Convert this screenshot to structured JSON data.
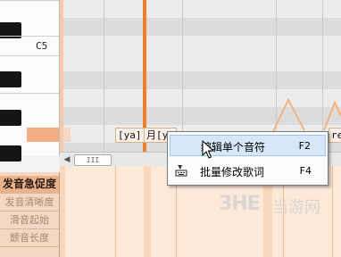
{
  "piano": {
    "octave_label": "C5"
  },
  "lyrics": {
    "note1": "[ya]",
    "note2_prefix": "月[ya",
    "note3": "re"
  },
  "scrollbar": {
    "thumb_label": "III",
    "left_arrow": "◀"
  },
  "parameters": {
    "items": [
      "发音急促度",
      "发音清晰度",
      "滑音起始",
      "颤音长度"
    ],
    "active_index": 0
  },
  "context_menu": {
    "items": [
      {
        "label": "编辑单个音符",
        "shortcut": "F2",
        "selected": true,
        "icon": "none"
      },
      {
        "label": "批量修改歌词",
        "shortcut": "F4",
        "selected": false,
        "icon": "keyboard-icon"
      }
    ]
  },
  "watermark": {
    "logo": "3HE",
    "text": "当游网"
  },
  "colors": {
    "accent": "#f07f2c",
    "param_panel": "#f4d8c4",
    "selection": "#d5e7f8"
  }
}
